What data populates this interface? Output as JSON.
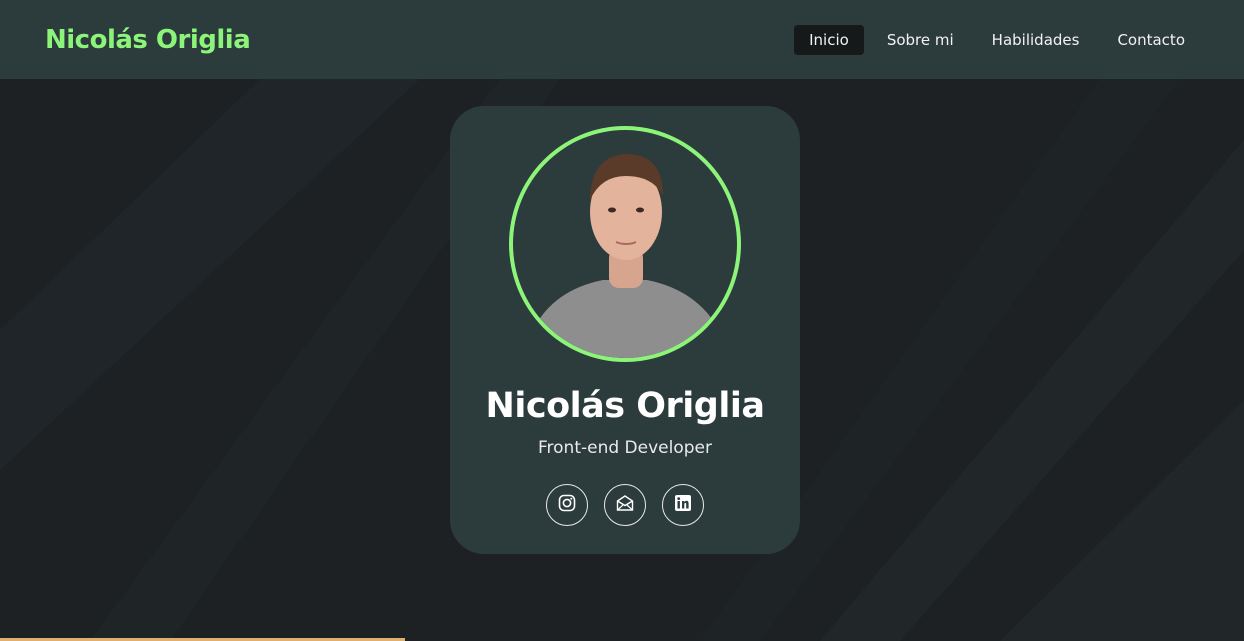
{
  "navbar": {
    "brand": "Nicolás Origlia",
    "links": [
      {
        "label": "Inicio",
        "active": true
      },
      {
        "label": "Sobre mi",
        "active": false
      },
      {
        "label": "Habilidades",
        "active": false
      },
      {
        "label": "Contacto",
        "active": false
      }
    ]
  },
  "profile": {
    "name": "Nicolás Origlia",
    "role": "Front-end Developer",
    "socials": [
      {
        "icon": "instagram-icon"
      },
      {
        "icon": "email-icon"
      },
      {
        "icon": "linkedin-icon"
      }
    ]
  },
  "colors": {
    "accent": "#8df47a",
    "navbar_bg": "#2c3b3b",
    "page_bg": "#1d2123",
    "card_bg": "#2c3b3b"
  }
}
